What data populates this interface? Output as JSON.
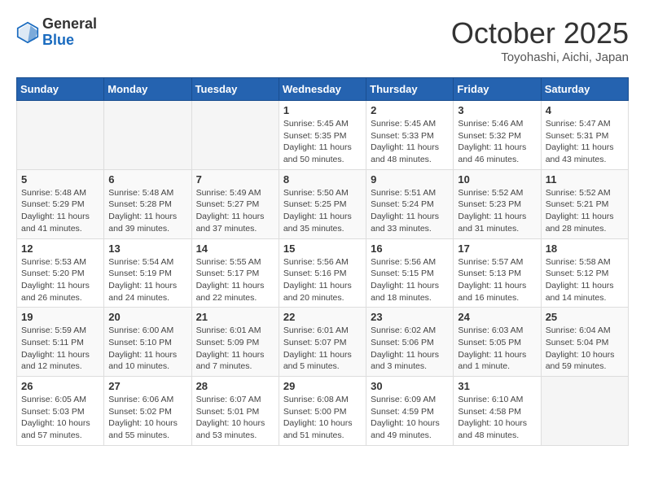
{
  "header": {
    "logo_general": "General",
    "logo_blue": "Blue",
    "month_title": "October 2025",
    "location": "Toyohashi, Aichi, Japan"
  },
  "weekdays": [
    "Sunday",
    "Monday",
    "Tuesday",
    "Wednesday",
    "Thursday",
    "Friday",
    "Saturday"
  ],
  "weeks": [
    [
      {
        "day": "",
        "info": ""
      },
      {
        "day": "",
        "info": ""
      },
      {
        "day": "",
        "info": ""
      },
      {
        "day": "1",
        "info": "Sunrise: 5:45 AM\nSunset: 5:35 PM\nDaylight: 11 hours\nand 50 minutes."
      },
      {
        "day": "2",
        "info": "Sunrise: 5:45 AM\nSunset: 5:33 PM\nDaylight: 11 hours\nand 48 minutes."
      },
      {
        "day": "3",
        "info": "Sunrise: 5:46 AM\nSunset: 5:32 PM\nDaylight: 11 hours\nand 46 minutes."
      },
      {
        "day": "4",
        "info": "Sunrise: 5:47 AM\nSunset: 5:31 PM\nDaylight: 11 hours\nand 43 minutes."
      }
    ],
    [
      {
        "day": "5",
        "info": "Sunrise: 5:48 AM\nSunset: 5:29 PM\nDaylight: 11 hours\nand 41 minutes."
      },
      {
        "day": "6",
        "info": "Sunrise: 5:48 AM\nSunset: 5:28 PM\nDaylight: 11 hours\nand 39 minutes."
      },
      {
        "day": "7",
        "info": "Sunrise: 5:49 AM\nSunset: 5:27 PM\nDaylight: 11 hours\nand 37 minutes."
      },
      {
        "day": "8",
        "info": "Sunrise: 5:50 AM\nSunset: 5:25 PM\nDaylight: 11 hours\nand 35 minutes."
      },
      {
        "day": "9",
        "info": "Sunrise: 5:51 AM\nSunset: 5:24 PM\nDaylight: 11 hours\nand 33 minutes."
      },
      {
        "day": "10",
        "info": "Sunrise: 5:52 AM\nSunset: 5:23 PM\nDaylight: 11 hours\nand 31 minutes."
      },
      {
        "day": "11",
        "info": "Sunrise: 5:52 AM\nSunset: 5:21 PM\nDaylight: 11 hours\nand 28 minutes."
      }
    ],
    [
      {
        "day": "12",
        "info": "Sunrise: 5:53 AM\nSunset: 5:20 PM\nDaylight: 11 hours\nand 26 minutes."
      },
      {
        "day": "13",
        "info": "Sunrise: 5:54 AM\nSunset: 5:19 PM\nDaylight: 11 hours\nand 24 minutes."
      },
      {
        "day": "14",
        "info": "Sunrise: 5:55 AM\nSunset: 5:17 PM\nDaylight: 11 hours\nand 22 minutes."
      },
      {
        "day": "15",
        "info": "Sunrise: 5:56 AM\nSunset: 5:16 PM\nDaylight: 11 hours\nand 20 minutes."
      },
      {
        "day": "16",
        "info": "Sunrise: 5:56 AM\nSunset: 5:15 PM\nDaylight: 11 hours\nand 18 minutes."
      },
      {
        "day": "17",
        "info": "Sunrise: 5:57 AM\nSunset: 5:13 PM\nDaylight: 11 hours\nand 16 minutes."
      },
      {
        "day": "18",
        "info": "Sunrise: 5:58 AM\nSunset: 5:12 PM\nDaylight: 11 hours\nand 14 minutes."
      }
    ],
    [
      {
        "day": "19",
        "info": "Sunrise: 5:59 AM\nSunset: 5:11 PM\nDaylight: 11 hours\nand 12 minutes."
      },
      {
        "day": "20",
        "info": "Sunrise: 6:00 AM\nSunset: 5:10 PM\nDaylight: 11 hours\nand 10 minutes."
      },
      {
        "day": "21",
        "info": "Sunrise: 6:01 AM\nSunset: 5:09 PM\nDaylight: 11 hours\nand 7 minutes."
      },
      {
        "day": "22",
        "info": "Sunrise: 6:01 AM\nSunset: 5:07 PM\nDaylight: 11 hours\nand 5 minutes."
      },
      {
        "day": "23",
        "info": "Sunrise: 6:02 AM\nSunset: 5:06 PM\nDaylight: 11 hours\nand 3 minutes."
      },
      {
        "day": "24",
        "info": "Sunrise: 6:03 AM\nSunset: 5:05 PM\nDaylight: 11 hours\nand 1 minute."
      },
      {
        "day": "25",
        "info": "Sunrise: 6:04 AM\nSunset: 5:04 PM\nDaylight: 10 hours\nand 59 minutes."
      }
    ],
    [
      {
        "day": "26",
        "info": "Sunrise: 6:05 AM\nSunset: 5:03 PM\nDaylight: 10 hours\nand 57 minutes."
      },
      {
        "day": "27",
        "info": "Sunrise: 6:06 AM\nSunset: 5:02 PM\nDaylight: 10 hours\nand 55 minutes."
      },
      {
        "day": "28",
        "info": "Sunrise: 6:07 AM\nSunset: 5:01 PM\nDaylight: 10 hours\nand 53 minutes."
      },
      {
        "day": "29",
        "info": "Sunrise: 6:08 AM\nSunset: 5:00 PM\nDaylight: 10 hours\nand 51 minutes."
      },
      {
        "day": "30",
        "info": "Sunrise: 6:09 AM\nSunset: 4:59 PM\nDaylight: 10 hours\nand 49 minutes."
      },
      {
        "day": "31",
        "info": "Sunrise: 6:10 AM\nSunset: 4:58 PM\nDaylight: 10 hours\nand 48 minutes."
      },
      {
        "day": "",
        "info": ""
      }
    ]
  ]
}
